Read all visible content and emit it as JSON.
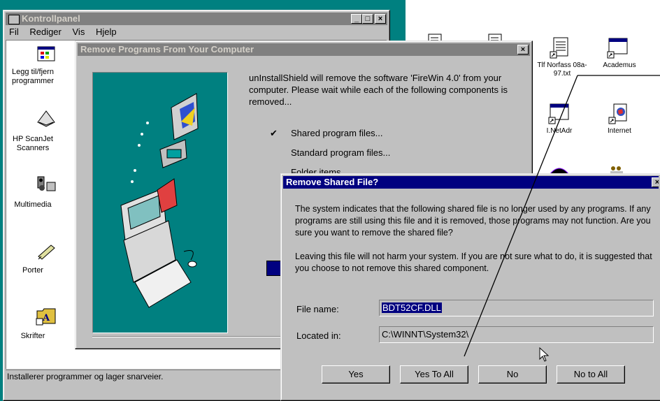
{
  "desktop": {
    "icons": [
      {
        "label": "Tlf Norfass 08a-97.txt",
        "icon": "text-file-icon"
      },
      {
        "label": "Academus",
        "icon": "window-shortcut-icon"
      },
      {
        "label": "I.NetAdr",
        "icon": "window-shortcut-icon"
      },
      {
        "label": "Internet",
        "icon": "internet-icon"
      }
    ]
  },
  "control_panel": {
    "title": "Kontrollpanel",
    "menu": [
      "Fil",
      "Rediger",
      "Vis",
      "Hjelp"
    ],
    "items": [
      {
        "label": "Legg til/fjern programmer",
        "icon": "add-remove-programs-icon"
      },
      {
        "label": "HP ScanJet Scanners",
        "icon": "scanner-icon"
      },
      {
        "label": "Multimedia",
        "icon": "multimedia-icon"
      },
      {
        "label": "Porter",
        "icon": "port-icon"
      },
      {
        "label": "Skrifter",
        "icon": "fonts-folder-icon"
      }
    ],
    "status": "Installerer programmer og lager snarveier."
  },
  "remove_programs": {
    "title": "Remove Programs From Your Computer",
    "message": "unInstallShield will remove the software 'FireWin 4.0' from your computer.  Please wait while each of the following components is removed...",
    "steps": [
      {
        "label": "Shared program files...",
        "checked": true
      },
      {
        "label": "Standard program files...",
        "checked": false
      },
      {
        "label": "Folder items...",
        "checked": false
      }
    ]
  },
  "shared_file_dialog": {
    "title": "Remove Shared File?",
    "paragraph1": "The system indicates that the following shared file is no longer used by any programs.  If any programs are still using this file and it is removed, those programs may not function.  Are you sure you want to remove the shared file?",
    "paragraph2": "Leaving this file will not harm your system.  If you are not sure what to do, it is suggested that you choose to not remove this shared component.",
    "file_name_label": "File name:",
    "file_name_value": "BDT52CF.DLL",
    "located_in_label": "Located in:",
    "located_in_value": "C:\\WINNT\\System32\\",
    "buttons": {
      "yes": "Yes",
      "yes_to_all": "Yes To All",
      "no": "No",
      "no_to_all": "No to All"
    }
  },
  "colors": {
    "title_active": "#000080",
    "title_inactive": "#808080",
    "teal": "#008080",
    "face": "#c0c0c0"
  }
}
